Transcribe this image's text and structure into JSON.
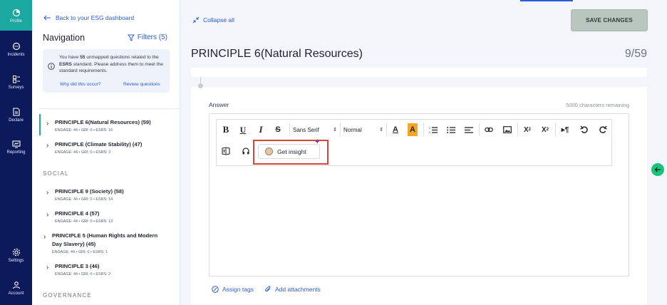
{
  "rail": {
    "items": [
      {
        "label": "Profile",
        "icon": "profile-icon"
      },
      {
        "label": "Incidents",
        "icon": "chat-icon"
      },
      {
        "label": "Surveys",
        "icon": "survey-icon"
      },
      {
        "label": "Declare",
        "icon": "declare-icon"
      },
      {
        "label": "Reporting",
        "icon": "reporting-icon"
      },
      {
        "label": "Settings",
        "icon": "gear-icon"
      },
      {
        "label": "Account",
        "icon": "user-icon"
      }
    ]
  },
  "nav": {
    "back_label": "Back to your ESG dashboard",
    "title": "Navigation",
    "filters_label": "Filters (5)",
    "notice": {
      "text_pre": "You have ",
      "count": "55",
      "text_mid": " unmapped questions related to the ",
      "standard": "ESRS",
      "text_post": " standard. Please address them to meet the standard requirements.",
      "link_why": "Why did this occur?",
      "link_review": "Review questions"
    },
    "principles": [
      {
        "title": "PRINCIPLE 6(Natural Resources) (59)",
        "meta": "ENGAGE: 44 • GRI: 0 • ESRS: 16"
      },
      {
        "title": "PRINCIPLE (Climate Stability) (47)",
        "meta": "ENGAGE: 44 • GRI: 0 • ESRS: 3"
      }
    ],
    "social_label": "SOCIAL",
    "social": [
      {
        "title": "PRINCIPLE 9 (Society) (58)",
        "meta": "ENGAGE: 44 • GRI: 0 • ESRS: 14"
      },
      {
        "title": "PRINCIPLE 4 (57)",
        "meta": "ENGAGE: 44 • GRI: 0 • ESRS: 13"
      },
      {
        "title": "PRINCIPLE 5 (Human Rights and Modern",
        "title2": "Day Slavery) (45)",
        "meta": "ENGAGE: 44 • GRI: 0 • ESRS: 1"
      },
      {
        "title": "PRINCIPLE 3 (46)",
        "meta": "ENGAGE: 44 • GRI: 0 • ESRS: 2"
      }
    ],
    "governance_label": "GOVERNANCE"
  },
  "main": {
    "collapse_label": "Collapse all",
    "save_label": "SAVE CHANGES",
    "title": "PRINCIPLE 6(Natural Resources)",
    "count": "9/59",
    "answer_label": "Answer",
    "chars_remaining": "5000 characters remaining",
    "toolbar": {
      "bold": "B",
      "underline": "U",
      "italic": "I",
      "strike": "S",
      "font_family": "Sans Serif",
      "font_size": "Normal",
      "color": "A",
      "highlight": "A",
      "subscript_base": "X",
      "subscript": "2",
      "superscript_base": "X",
      "superscript": "2",
      "get_insight": "Get insight"
    },
    "assign_tags": "Assign tags",
    "add_attachments": "Add attachments"
  },
  "colors": {
    "rail": "#0c1a5b",
    "accent": "#2b5bd7",
    "active": "#1aa8a0",
    "highlight_box": "#d94734",
    "float_button": "#1ac27a"
  }
}
